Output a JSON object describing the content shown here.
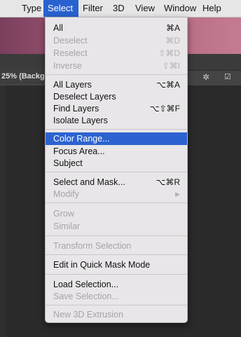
{
  "menubar": {
    "items": [
      {
        "label": "Type"
      },
      {
        "label": "Select"
      },
      {
        "label": "Filter"
      },
      {
        "label": "3D"
      },
      {
        "label": "View"
      },
      {
        "label": "Window"
      },
      {
        "label": "Help"
      }
    ],
    "active": "Select"
  },
  "document_tab": {
    "label": "25% (Backg"
  },
  "toolbar_icons": {
    "swap": "⇄",
    "gear": "✲",
    "checkbox": "☑"
  },
  "colors": {
    "menu_highlight": "#2c63d0",
    "menu_background": "#e8e6e8",
    "disabled_text": "#a6a4a7"
  },
  "select_menu": {
    "all": {
      "label": "All",
      "shortcut": "⌘A"
    },
    "deselect": {
      "label": "Deselect",
      "shortcut": "⌘D"
    },
    "reselect": {
      "label": "Reselect",
      "shortcut": "⇧⌘D"
    },
    "inverse": {
      "label": "Inverse",
      "shortcut": "⇧⌘I"
    },
    "all_layers": {
      "label": "All Layers",
      "shortcut": "⌥⌘A"
    },
    "deselect_layers": {
      "label": "Deselect Layers"
    },
    "find_layers": {
      "label": "Find Layers",
      "shortcut": "⌥⇧⌘F"
    },
    "isolate_layers": {
      "label": "Isolate Layers"
    },
    "color_range": {
      "label": "Color Range..."
    },
    "focus_area": {
      "label": "Focus Area..."
    },
    "subject": {
      "label": "Subject"
    },
    "select_and_mask": {
      "label": "Select and Mask...",
      "shortcut": "⌥⌘R"
    },
    "modify": {
      "label": "Modify",
      "submenu_arrow": "▶"
    },
    "grow": {
      "label": "Grow"
    },
    "similar": {
      "label": "Similar"
    },
    "transform_selection": {
      "label": "Transform Selection"
    },
    "quick_mask": {
      "label": "Edit in Quick Mask Mode"
    },
    "load_selection": {
      "label": "Load Selection..."
    },
    "save_selection": {
      "label": "Save Selection..."
    },
    "new_3d_extrusion": {
      "label": "New 3D Extrusion"
    }
  }
}
